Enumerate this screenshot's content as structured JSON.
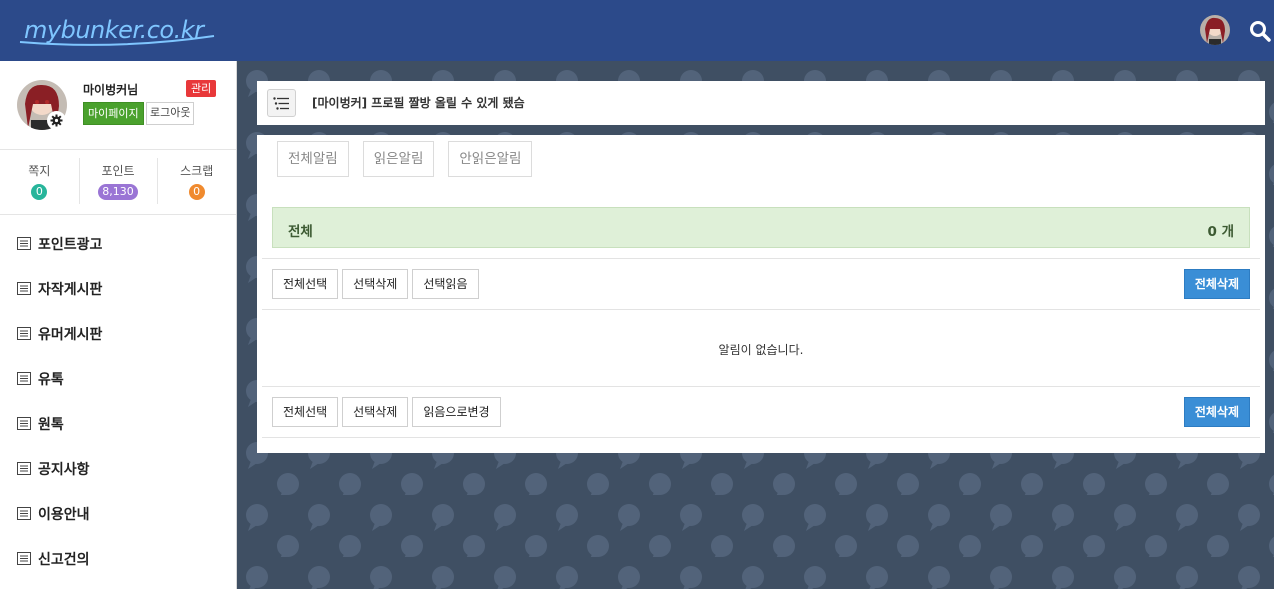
{
  "header": {
    "logo_text": "mybunker.co.kr",
    "avatar_icon": "avatar-icon",
    "search_icon": "search-icon"
  },
  "sidebar": {
    "profile": {
      "username": "마이벙커님",
      "admin_badge": "관리",
      "mypage_label": "마이페이지",
      "logout_label": "로그아웃"
    },
    "stats": [
      {
        "label": "쪽지",
        "value": "0",
        "color": "#27b59b"
      },
      {
        "label": "포인트",
        "value": "8,130",
        "color": "#9a75d5"
      },
      {
        "label": "스크랩",
        "value": "0",
        "color": "#f08a2e"
      }
    ],
    "menu": [
      {
        "label": "포인트광고"
      },
      {
        "label": "자작게시판"
      },
      {
        "label": "유머게시판"
      },
      {
        "label": "유톡"
      },
      {
        "label": "원톡"
      },
      {
        "label": "공지사항"
      },
      {
        "label": "이용안내"
      },
      {
        "label": "신고건의"
      }
    ]
  },
  "notice": {
    "text": "[마이벙커] 프로필 짤방 올릴 수 있게 됐슴"
  },
  "alerts": {
    "tabs": [
      "전체알림",
      "읽은알림",
      "안읽은알림"
    ],
    "summary_label": "전체",
    "summary_count": "0 개",
    "top_actions": [
      "전체선택",
      "선택삭제",
      "선택읽음"
    ],
    "bottom_actions": [
      "전체선택",
      "선택삭제",
      "읽음으로변경"
    ],
    "delete_all_label": "전체삭제",
    "empty_message": "알림이 없습니다."
  },
  "colors": {
    "header_bg": "#2c4a8a",
    "background": "#3f4f63",
    "summary_bg": "#dff0d8",
    "primary_button": "#3a8ed6",
    "mypage_green": "#4aa12d",
    "admin_red": "#e8383a"
  }
}
